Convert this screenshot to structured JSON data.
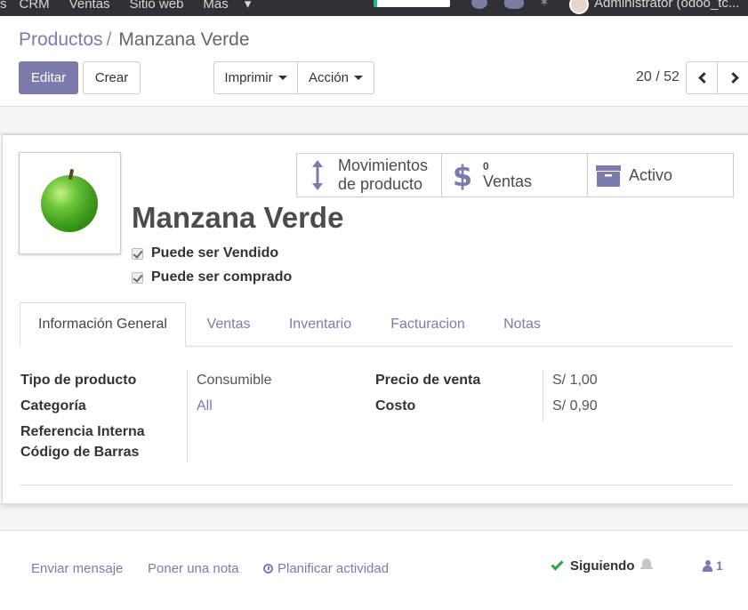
{
  "topbar": {
    "menu": [
      "s",
      "CRM",
      "Ventas",
      "Sitio web",
      "Más"
    ],
    "user": "Administrator (odoo_tc..."
  },
  "breadcrumb": {
    "parent": "Productos",
    "separator": "/",
    "current": "Manzana Verde"
  },
  "toolbar": {
    "edit_label": "Editar",
    "create_label": "Crear",
    "print_label": "Imprimir",
    "action_label": "Acción"
  },
  "pager": {
    "value": "20 / 52"
  },
  "smart_buttons": {
    "moves_line1": "Movimientos",
    "moves_line2": "de producto",
    "sales_count": "0",
    "sales_label": "Ventas",
    "active_label": "Activo"
  },
  "product": {
    "name": "Manzana Verde",
    "sale_ok_label": "Puede ser Vendido",
    "purchase_ok_label": "Puede ser comprado"
  },
  "tabs": [
    {
      "label": "Información General",
      "active": true
    },
    {
      "label": "Ventas",
      "active": false
    },
    {
      "label": "Inventario",
      "active": false
    },
    {
      "label": "Facturacion",
      "active": false
    },
    {
      "label": "Notas",
      "active": false
    }
  ],
  "general_info": {
    "type_label": "Tipo de producto",
    "type_value": "Consumible",
    "category_label": "Categoría",
    "category_value": "All",
    "ref_label": "Referencia Interna",
    "barcode_label": "Código de Barras",
    "price_label": "Precio de venta",
    "price_value": "S/ 1,00",
    "cost_label": "Costo",
    "cost_value": "S/ 0,90"
  },
  "chatter": {
    "send_message": "Enviar mensaje",
    "log_note": "Poner una nota",
    "schedule_activity": "Planificar actividad",
    "following": "Siguiendo",
    "followers_count": "1"
  },
  "colors": {
    "primary": "#7c7bad",
    "success": "#28a745",
    "topbar": "#2f3136"
  }
}
